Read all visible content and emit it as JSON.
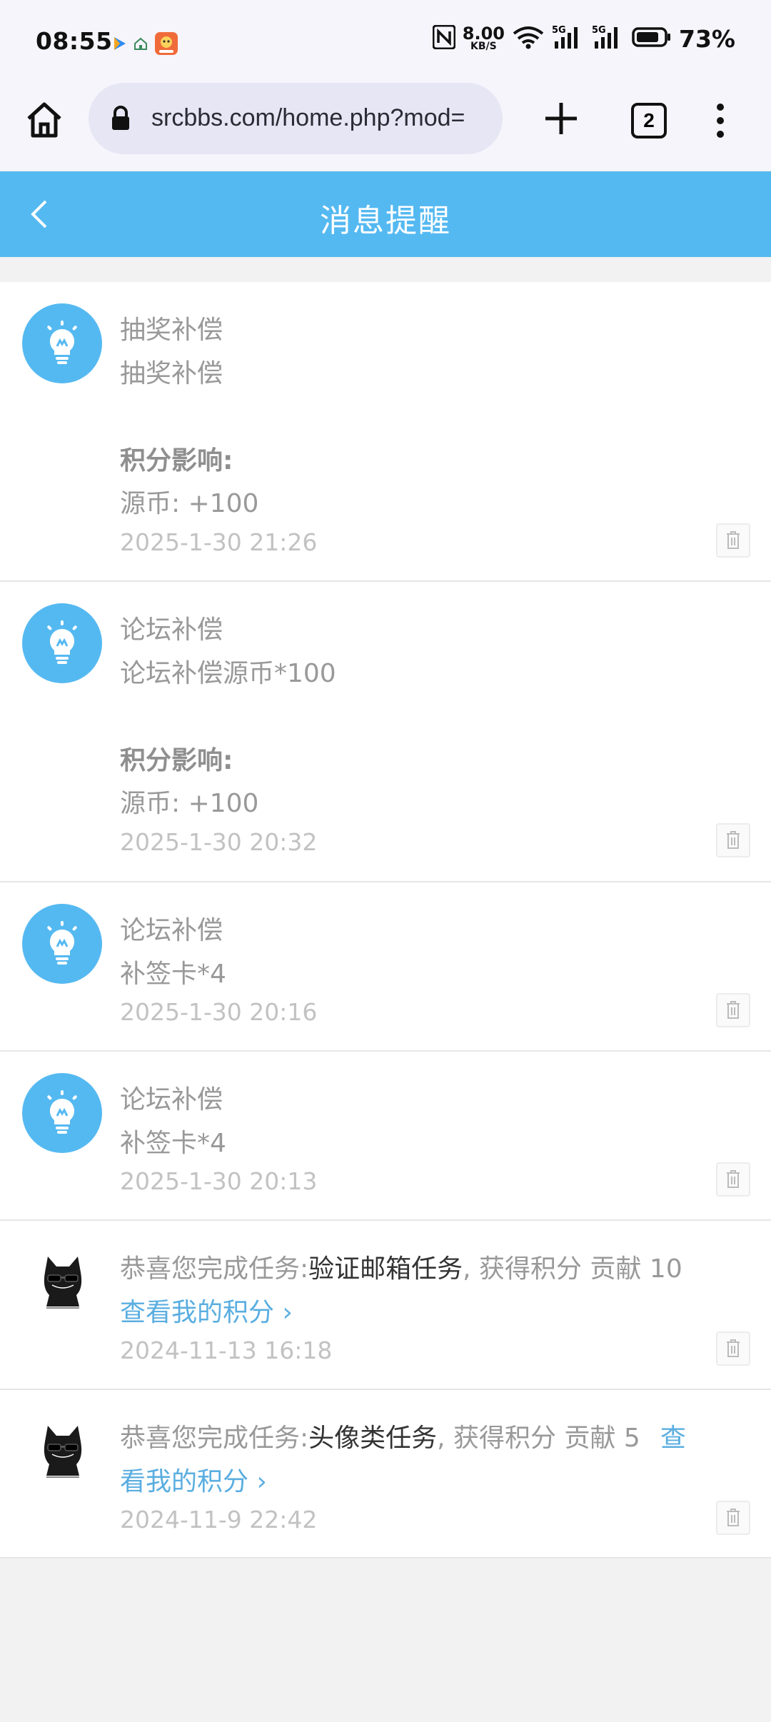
{
  "status_bar": {
    "time": "08:55",
    "net_speed_value": "8.00",
    "net_speed_unit": "KB/S",
    "battery_percent": "73%",
    "icons": [
      "nfc-icon",
      "wifi-icon",
      "signal-5g-icon",
      "signal-5g-icon",
      "battery-icon"
    ]
  },
  "browser": {
    "url": "srcbbs.com/home.php?mod=",
    "tab_count": "2"
  },
  "header": {
    "title": "消息提醒"
  },
  "colors": {
    "accent": "#55b9f1",
    "link": "#5aaee0",
    "muted_text": "#999999",
    "date_text": "#c2c2c2"
  },
  "notifications": [
    {
      "avatar": "lightbulb-icon",
      "title": "抽奖补偿",
      "body": "抽奖补偿",
      "impact_label": "积分影响:",
      "impact_value": "源币: +100",
      "time": "2025-1-30 21:26"
    },
    {
      "avatar": "lightbulb-icon",
      "title": "论坛补偿",
      "body": "论坛补偿源币*100",
      "impact_label": "积分影响:",
      "impact_value": "源币: +100",
      "time": "2025-1-30 20:32"
    },
    {
      "avatar": "lightbulb-icon",
      "title": "论坛补偿",
      "body": "补签卡*4",
      "time": "2025-1-30 20:16"
    },
    {
      "avatar": "lightbulb-icon",
      "title": "论坛补偿",
      "body": "补签卡*4",
      "time": "2025-1-30 20:13"
    },
    {
      "avatar": "cat-avatar",
      "prefix": "恭喜您完成任务:",
      "task": "验证邮箱任务",
      "suffix": ", 获得积分 贡献 10",
      "link": "查看我的积分 ›",
      "time": "2024-11-13 16:18"
    },
    {
      "avatar": "cat-avatar",
      "prefix": "恭喜您完成任务:",
      "task": "头像类任务",
      "suffix": ", 获得积分 贡献 5",
      "link_part1": "查",
      "link_part2": "看我的积分 ›",
      "time": "2024-11-9 22:42"
    }
  ]
}
